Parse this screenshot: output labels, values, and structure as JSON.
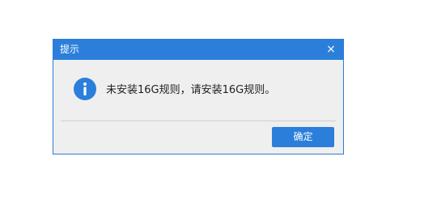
{
  "dialog": {
    "title": "提示",
    "close_label": "×",
    "message": "未安装16G规则，请安装16G规则。",
    "icon": "info-icon",
    "ok_label": "确定"
  },
  "colors": {
    "titlebar": "#2b7fdb",
    "button": "#2b7fdb",
    "dialog_bg": "#efefef",
    "icon": "#2b7fdb"
  }
}
